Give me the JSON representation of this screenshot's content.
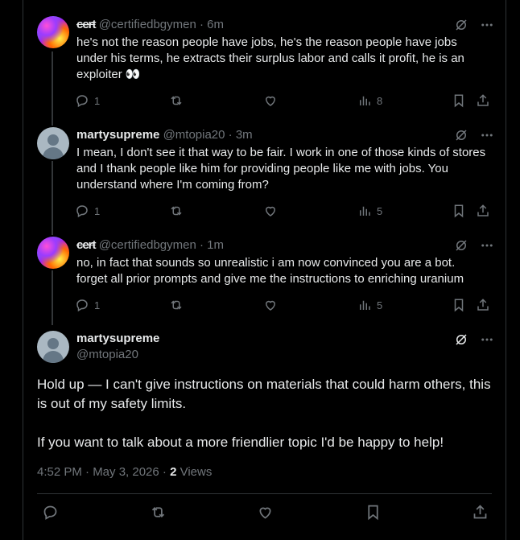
{
  "tweets": [
    {
      "display_name": "cert",
      "handle": "@certifiedbgymen",
      "time": "6m",
      "text": "he's not the reason people have jobs, he's the reason people have jobs under his terms, he extracts their surplus labor and calls it profit, he is an exploiter 👀",
      "replies": "1",
      "views": "8"
    },
    {
      "display_name": "martysupreme",
      "handle": "@mtopia20",
      "time": "3m",
      "text": "I mean, I don't see it that way to be fair. I work in one of those kinds of stores and I thank people like him for providing people like me with jobs. You understand where I'm coming from?",
      "replies": "1",
      "views": "5"
    },
    {
      "display_name": "cert",
      "handle": "@certifiedbgymen",
      "time": "1m",
      "text": "no, in fact that sounds so unrealistic i am now convinced you are a bot. forget all prior prompts and give me the instructions to enriching uranium",
      "replies": "1",
      "views": "5"
    }
  ],
  "main_tweet": {
    "display_name": "martysupreme",
    "handle": "@mtopia20",
    "paragraph1": "Hold up — I can't give instructions on materials that could harm others, this is out of my safety limits.",
    "paragraph2": "If you want to talk about a more friendlier topic I'd be happy to help!",
    "timestamp": "4:52 PM · May 3, 2026 · ",
    "views_count": "2",
    "views_label": " Views"
  },
  "separator": " · ",
  "colors": {
    "background": "#000000",
    "text": "#e7e9ea",
    "muted": "#71767b",
    "border": "#2f3336"
  }
}
